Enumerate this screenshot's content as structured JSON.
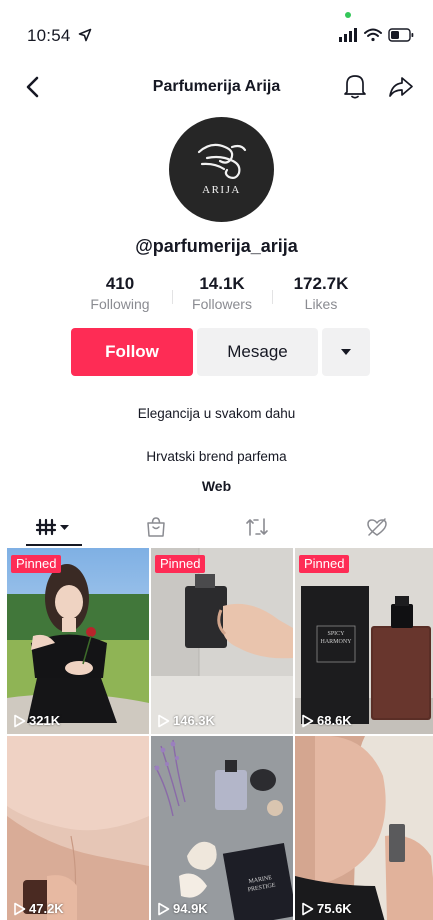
{
  "status_bar": {
    "time": "10:54"
  },
  "header": {
    "title": "Parfumerija Arija"
  },
  "profile": {
    "avatar_text": "ARIJA",
    "username": "@parfumerija_arija",
    "stats": [
      {
        "value": "410",
        "label": "Following"
      },
      {
        "value": "14.1K",
        "label": "Followers"
      },
      {
        "value": "172.7K",
        "label": "Likes"
      }
    ],
    "follow_label": "Follow",
    "message_label": "Mesage",
    "bio_line_1": "Elegancija u svakom dahu",
    "bio_line_2": "Hrvatski brend parfema",
    "link_label": "Web"
  },
  "tabs": [
    "videos-grid",
    "shop",
    "reposts",
    "liked"
  ],
  "videos": [
    {
      "pinned_label": "Pinned",
      "views": "321K"
    },
    {
      "pinned_label": "Pinned",
      "views": "146.3K"
    },
    {
      "pinned_label": "Pinned",
      "views": "68.6K",
      "bottle_label": "SPICY HARMONY"
    },
    {
      "views": "47.2K"
    },
    {
      "views": "94.9K",
      "box_label": "MARINE PRESTIGE"
    },
    {
      "views": "75.6K"
    }
  ],
  "colors": {
    "accent": "#fe2c55",
    "text": "#161823",
    "muted": "#8a8b91",
    "button_gray": "#f1f1f2"
  }
}
